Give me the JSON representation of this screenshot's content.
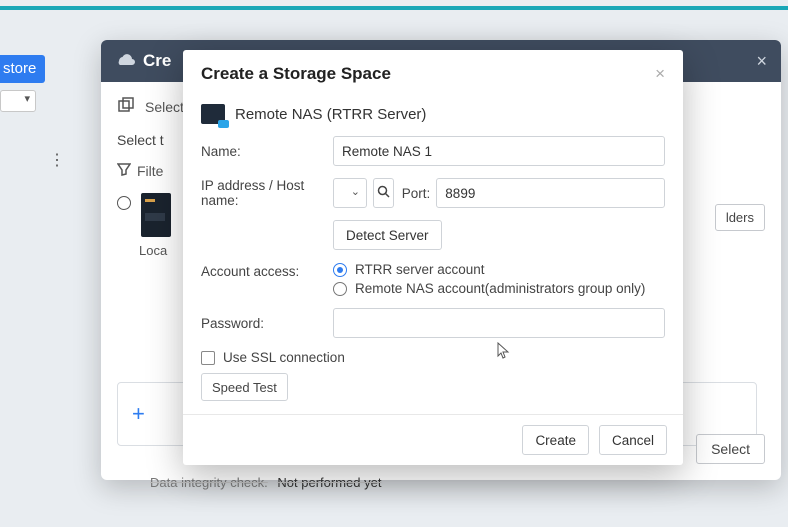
{
  "bg": {
    "left_label": "store"
  },
  "win2": {
    "title": "Cre",
    "select_label": "Select",
    "select_t": "Select t",
    "filter_label": "Filte",
    "local_label": "Loca",
    "folders_btn": "lders",
    "select_btn": "Select",
    "integrity_label": "Data integrity check.",
    "integrity_value": "Not performed yet"
  },
  "modal": {
    "title": "Create a Storage Space",
    "subtitle": "Remote NAS (RTRR Server)",
    "name_label": "Name:",
    "name_value": "Remote NAS 1",
    "ip_label": "IP address / Host name:",
    "port_label": "Port:",
    "port_value": "8899",
    "detect_btn": "Detect Server",
    "account_label": "Account access:",
    "radio1": "RTRR server account",
    "radio2": "Remote NAS account(administrators group only)",
    "password_label": "Password:",
    "ssl_label": "Use SSL connection",
    "speed_btn": "Speed Test",
    "create_btn": "Create",
    "cancel_btn": "Cancel"
  }
}
